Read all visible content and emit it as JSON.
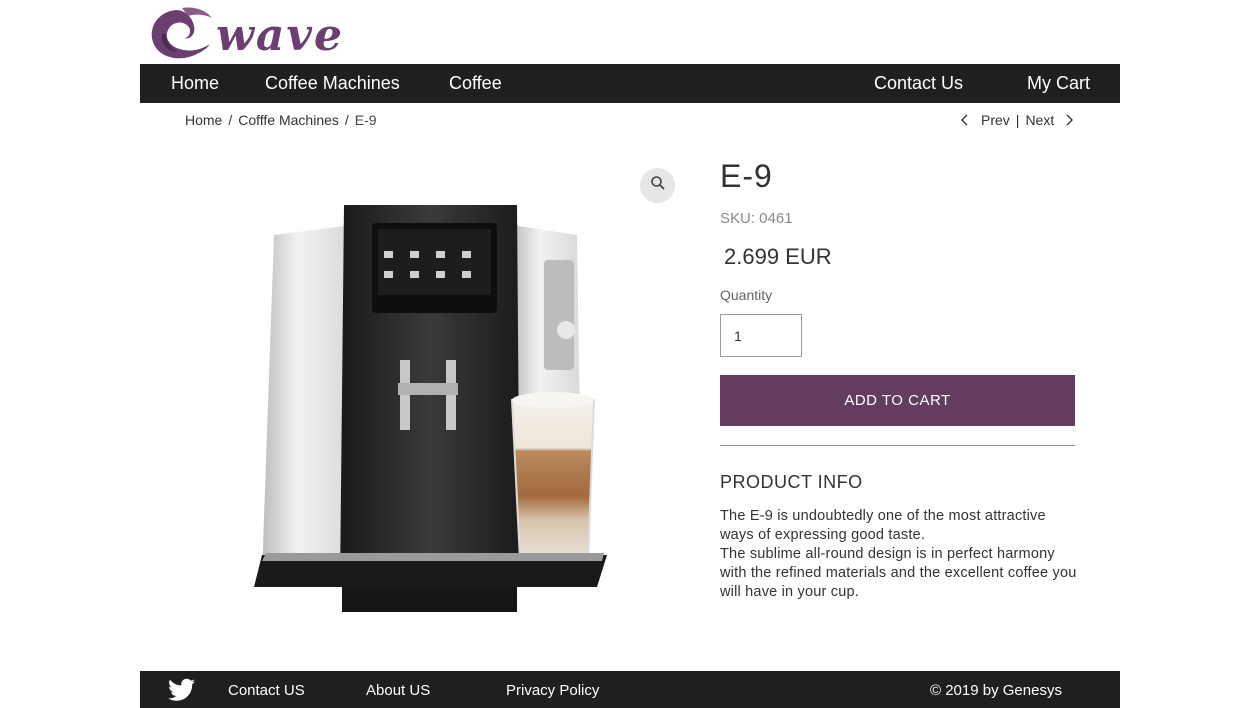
{
  "brand": {
    "logo_text": "wave"
  },
  "nav": {
    "home": "Home",
    "coffee_machines": "Coffee Machines",
    "coffee": "Coffee",
    "contact": "Contact Us",
    "cart": "My Cart"
  },
  "breadcrumb": {
    "items": [
      "Home",
      "Cofffe Machines"
    ],
    "current": "E-9",
    "separator": "/"
  },
  "pager": {
    "prev": "Prev",
    "divider": "|",
    "next": "Next"
  },
  "product": {
    "name": "E-9",
    "sku": "SKU: 0461",
    "price": "2.699 EUR",
    "quantity_label": "Quantity",
    "quantity_value": "1",
    "add_to_cart": "ADD TO CART",
    "info_title": "PRODUCT INFO",
    "info_text_1": "The E-9 is undoubtedly one of the most attractive ways of expressing good taste.",
    "info_text_2": "The sublime all-round design is in perfect harmony with the refined materials and the excellent coffee you will have in your cup."
  },
  "footer": {
    "contact": "Contact US",
    "about": "About US",
    "privacy": "Privacy Policy",
    "copyright": "©  2019 by Genesys"
  },
  "icons": {
    "zoom": "magnifier-icon",
    "twitter": "twitter-icon",
    "prev": "chevron-left-icon",
    "next": "chevron-right-icon"
  },
  "colors": {
    "brand_purple": "#633c60",
    "nav_bg": "#1f1f1f",
    "logo_purple": "#6b3f6f"
  }
}
